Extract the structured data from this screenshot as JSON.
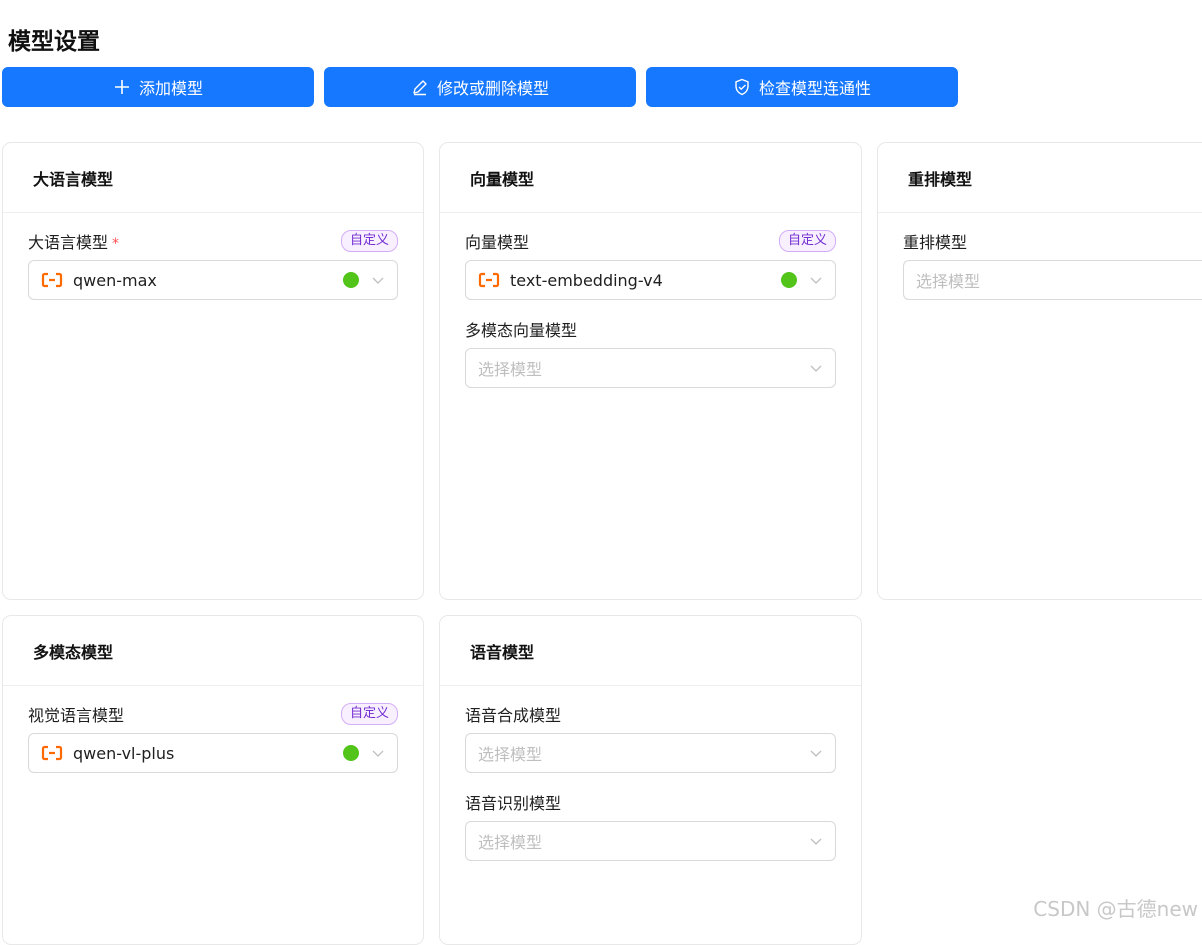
{
  "page": {
    "title": "模型设置"
  },
  "toolbar": {
    "add_label": "添加模型",
    "edit_label": "修改或删除模型",
    "check_label": "检查模型连通性"
  },
  "cards": {
    "llm": {
      "title": "大语言模型",
      "fields": [
        {
          "label": "大语言模型",
          "required": "*",
          "tag": "自定义",
          "value": "qwen-max",
          "status": "online"
        }
      ]
    },
    "embedding": {
      "title": "向量模型",
      "fields": [
        {
          "label": "向量模型",
          "tag": "自定义",
          "value": "text-embedding-v4",
          "status": "online"
        },
        {
          "label": "多模态向量模型",
          "placeholder": "选择模型"
        }
      ]
    },
    "rerank": {
      "title": "重排模型",
      "fields": [
        {
          "label": "重排模型",
          "placeholder": "选择模型"
        }
      ]
    },
    "multimodal": {
      "title": "多模态模型",
      "fields": [
        {
          "label": "视觉语言模型",
          "tag": "自定义",
          "value": "qwen-vl-plus",
          "status": "online"
        }
      ]
    },
    "speech": {
      "title": "语音模型",
      "fields": [
        {
          "label": "语音合成模型",
          "placeholder": "选择模型"
        },
        {
          "label": "语音识别模型",
          "placeholder": "选择模型"
        }
      ]
    }
  },
  "colors": {
    "primary": "#1677ff",
    "status_online": "#52c41a",
    "provider": "#ff6a00",
    "tag": "#722ed1"
  },
  "icons": {
    "add": "plus-icon",
    "edit": "pencil-icon",
    "check": "shield-check-icon",
    "provider": "aliyun-logo-icon",
    "dropdown": "chevron-down-icon"
  },
  "watermark": "CSDN @古德new"
}
